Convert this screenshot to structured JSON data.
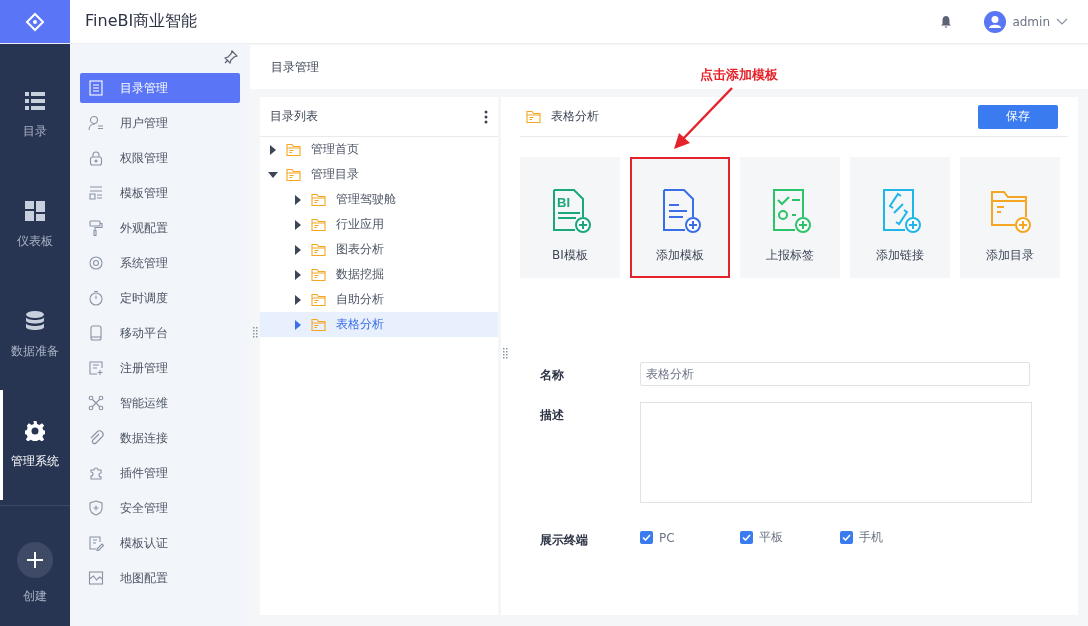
{
  "app": {
    "title": "FineBI商业智能",
    "user": "admin"
  },
  "nav": [
    {
      "label": "目录",
      "selected": false
    },
    {
      "label": "仪表板",
      "selected": false
    },
    {
      "label": "数据准备",
      "selected": false
    },
    {
      "label": "管理系统",
      "selected": true
    }
  ],
  "create": {
    "label": "创建"
  },
  "menu": [
    {
      "label": "目录管理",
      "selected": true
    },
    {
      "label": "用户管理",
      "selected": false
    },
    {
      "label": "权限管理",
      "selected": false
    },
    {
      "label": "模板管理",
      "selected": false
    },
    {
      "label": "外观配置",
      "selected": false
    },
    {
      "label": "系统管理",
      "selected": false
    },
    {
      "label": "定时调度",
      "selected": false
    },
    {
      "label": "移动平台",
      "selected": false
    },
    {
      "label": "注册管理",
      "selected": false
    },
    {
      "label": "智能运维",
      "selected": false
    },
    {
      "label": "数据连接",
      "selected": false
    },
    {
      "label": "插件管理",
      "selected": false
    },
    {
      "label": "安全管理",
      "selected": false
    },
    {
      "label": "模板认证",
      "selected": false
    },
    {
      "label": "地图配置",
      "selected": false
    }
  ],
  "page_title": "目录管理",
  "tree": {
    "title": "目录列表",
    "items": [
      {
        "label": "管理首页",
        "expanded": false,
        "selected": false
      },
      {
        "label": "管理目录",
        "expanded": true,
        "selected": false,
        "children": [
          {
            "label": "管理驾驶舱",
            "expanded": false,
            "selected": false
          },
          {
            "label": "行业应用",
            "expanded": false,
            "selected": false
          },
          {
            "label": "图表分析",
            "expanded": false,
            "selected": false
          },
          {
            "label": "数据挖掘",
            "expanded": false,
            "selected": false
          },
          {
            "label": "自助分析",
            "expanded": false,
            "selected": false
          },
          {
            "label": "表格分析",
            "expanded": false,
            "selected": true
          }
        ]
      }
    ]
  },
  "detail": {
    "title": "表格分析",
    "save": "保存",
    "cards": [
      {
        "kind": "bi",
        "badge": "BI",
        "label": "BI模板",
        "highlighted": false
      },
      {
        "kind": "template",
        "label": "添加模板",
        "highlighted": true
      },
      {
        "kind": "report",
        "label": "上报标签",
        "highlighted": false
      },
      {
        "kind": "link",
        "label": "添加链接",
        "highlighted": false
      },
      {
        "kind": "folder",
        "label": "添加目录",
        "highlighted": false
      }
    ],
    "form": {
      "name_label": "名称",
      "name_value": "表格分析",
      "desc_label": "描述",
      "terminal_label": "展示终端",
      "terminals": [
        {
          "label": "PC",
          "checked": true
        },
        {
          "label": "平板",
          "checked": true
        },
        {
          "label": "手机",
          "checked": true
        }
      ]
    }
  },
  "annotation": {
    "text": "点击添加模板"
  }
}
